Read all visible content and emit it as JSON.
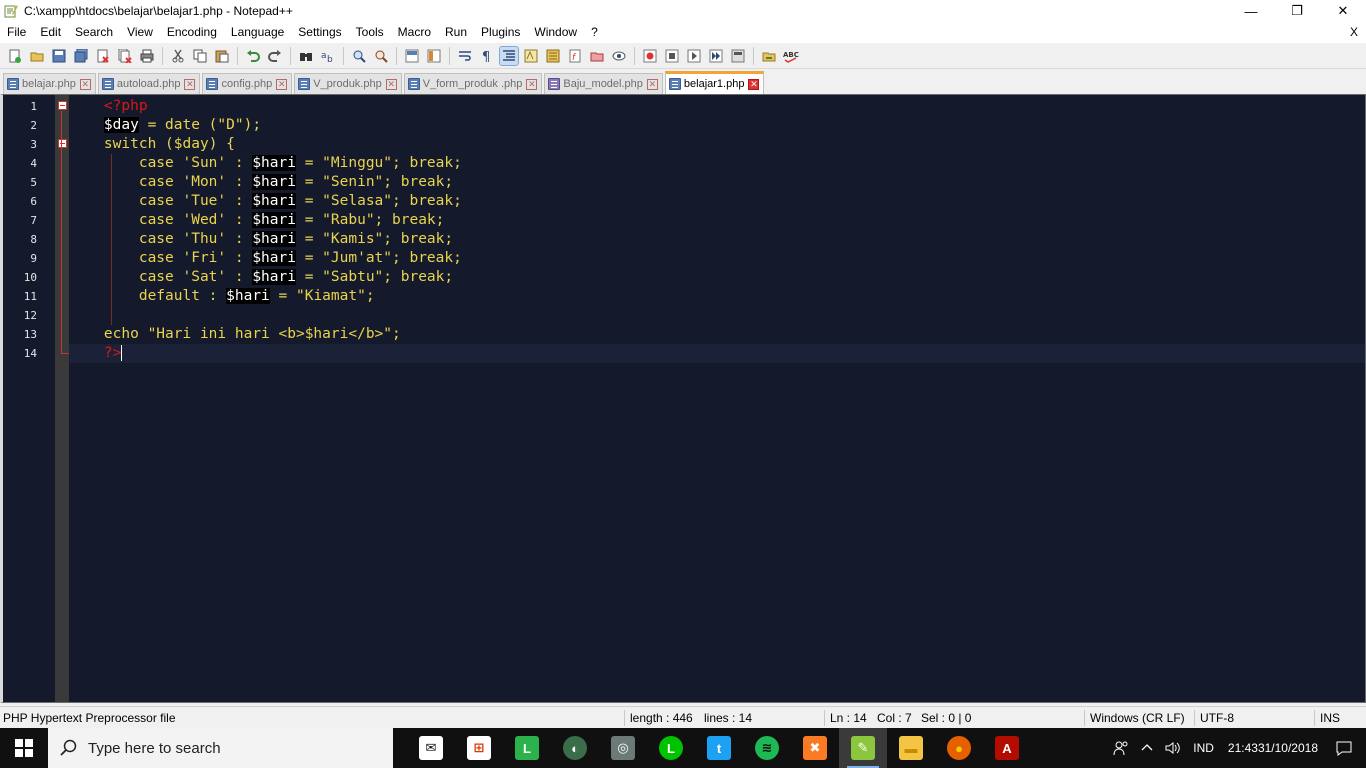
{
  "window": {
    "title": "C:\\xampp\\htdocs\\belajar\\belajar1.php - Notepad++",
    "minimize": "—",
    "maximize": "❐",
    "close": "✕"
  },
  "menu": {
    "items": [
      "File",
      "Edit",
      "Search",
      "View",
      "Encoding",
      "Language",
      "Settings",
      "Tools",
      "Macro",
      "Run",
      "Plugins",
      "Window",
      "?"
    ],
    "close_doc": "X"
  },
  "tabs": [
    {
      "label": "belajar.php",
      "active": false
    },
    {
      "label": "autoload.php",
      "active": false
    },
    {
      "label": "config.php",
      "active": false
    },
    {
      "label": "V_produk.php",
      "active": false
    },
    {
      "label": "V_form_produk .php",
      "active": false
    },
    {
      "label": "Baju_model.php",
      "active": false
    },
    {
      "label": "belajar1.php",
      "active": true
    }
  ],
  "editor": {
    "line_numbers": [
      "1",
      "2",
      "3",
      "4",
      "5",
      "6",
      "7",
      "8",
      "9",
      "10",
      "11",
      "12",
      "13",
      "14"
    ],
    "current_line": 14
  },
  "code": {
    "l1": "<?php",
    "l2": {
      "var": "$day",
      "rest": " = date (\"D\");"
    },
    "l3": {
      "a": "switch (",
      "var": "$day",
      "b": ") {"
    },
    "cases": [
      {
        "pre": "    case 'Sun' : ",
        "var": "$hari",
        "post": " = \"Minggu\"; break;"
      },
      {
        "pre": "    case 'Mon' : ",
        "var": "$hari",
        "post": " = \"Senin\"; break;"
      },
      {
        "pre": "    case 'Tue' : ",
        "var": "$hari",
        "post": " = \"Selasa\"; break;"
      },
      {
        "pre": "    case 'Wed' : ",
        "var": "$hari",
        "post": " = \"Rabu\"; break;"
      },
      {
        "pre": "    case 'Thu' : ",
        "var": "$hari",
        "post": " = \"Kamis\"; break;"
      },
      {
        "pre": "    case 'Fri' : ",
        "var": "$hari",
        "post": " = \"Jum'at\"; break;"
      },
      {
        "pre": "    case 'Sat' : ",
        "var": "$hari",
        "post": " = \"Sabtu\"; break;"
      },
      {
        "pre": "    default : ",
        "var": "$hari",
        "post": " = \"Kiamat\";"
      }
    ],
    "l13": "echo \"Hari ini hari <b>$hari</b>\";",
    "l14": "?>"
  },
  "status": {
    "file_type": "PHP Hypertext Preprocessor file",
    "length": "length : 446",
    "lines": "lines : 14",
    "ln": "Ln : 14",
    "col": "Col : 7",
    "sel": "Sel : 0 | 0",
    "eol": "Windows (CR LF)",
    "encoding": "UTF-8",
    "mode": "INS"
  },
  "taskbar": {
    "search_placeholder": "Type here to search",
    "apps": [
      {
        "name": "mail-app-icon",
        "glyph": "✉",
        "color": "#ffffff",
        "fg": "#101010"
      },
      {
        "name": "store-app-icon",
        "glyph": "⊞",
        "color": "#ffffff",
        "fg": "#d83b01"
      },
      {
        "name": "line-today-app-icon",
        "glyph": "L",
        "color": "#2bb24c",
        "fg": "#ffffff"
      },
      {
        "name": "whatsapp-app-icon",
        "glyph": "◐",
        "color": "#3a6e4a",
        "fg": "#ffffff"
      },
      {
        "name": "instagram-app-icon",
        "glyph": "◎",
        "color": "#6b7a77",
        "fg": "#ffffff"
      },
      {
        "name": "line-app-icon",
        "glyph": "L",
        "color": "#00c300",
        "fg": "#ffffff"
      },
      {
        "name": "twitter-app-icon",
        "glyph": "t",
        "color": "#1da1f2",
        "fg": "#ffffff"
      },
      {
        "name": "spotify-app-icon",
        "glyph": "≋",
        "color": "#1db954",
        "fg": "#101010"
      },
      {
        "name": "xampp-app-icon",
        "glyph": "✖",
        "color": "#fb7a24",
        "fg": "#ffffff"
      },
      {
        "name": "notepadpp-app-icon",
        "glyph": "✎",
        "color": "#8cc63f",
        "fg": "#ffffff"
      },
      {
        "name": "file-explorer-app-icon",
        "glyph": "▬",
        "color": "#f4c542",
        "fg": "#c98a00"
      },
      {
        "name": "firefox-app-icon",
        "glyph": "●",
        "color": "#e66000",
        "fg": "#ffcb00"
      },
      {
        "name": "acrobat-app-icon",
        "glyph": "A",
        "color": "#b30b00",
        "fg": "#ffffff"
      }
    ],
    "language": "IND",
    "time": "21:43",
    "date": "31/10/2018"
  }
}
